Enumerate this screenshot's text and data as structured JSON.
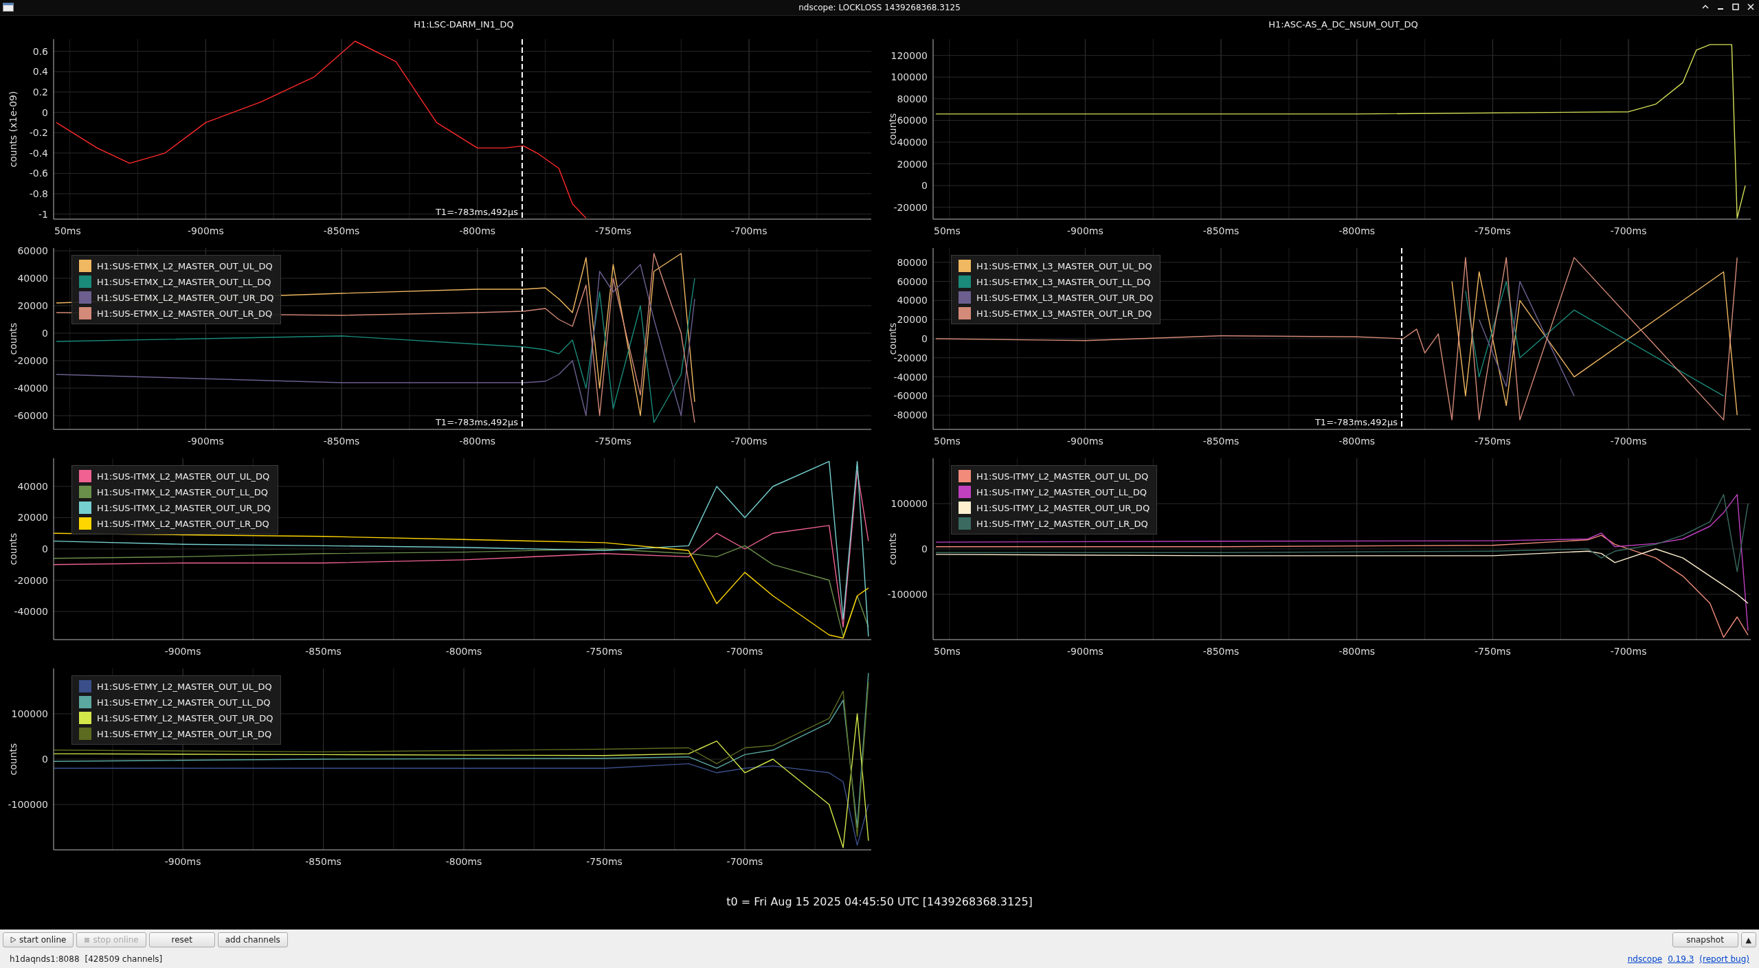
{
  "window": {
    "title": "ndscope: LOCKLOSS 1439268368.3125"
  },
  "plots": [
    {
      "cut_tick_label": "50ms",
      "chart_data": {
        "type": "line",
        "title": "H1:LSC-DARM_IN1_DQ",
        "ylabel": "counts (x1e-09)",
        "grid": true,
        "x": [
          -955,
          -940,
          -928,
          -915,
          -900,
          -880,
          -860,
          -845,
          -830,
          -815,
          -800,
          -790,
          -783,
          -778,
          -770,
          -765,
          -760
        ],
        "series": [
          {
            "color": "#ff2a2a",
            "values": [
              -0.1,
              -0.35,
              -0.5,
              -0.4,
              -0.1,
              0.1,
              0.35,
              0.7,
              0.5,
              -0.1,
              -0.35,
              -0.35,
              -0.33,
              -0.4,
              -0.55,
              -0.9,
              -1.04
            ]
          }
        ],
        "xlim": [
          -956,
          -655
        ],
        "ylim": [
          -1.05,
          0.72
        ],
        "xticks": [
          {
            "value": -900,
            "label": "-900ms"
          },
          {
            "value": -850,
            "label": "-850ms"
          },
          {
            "value": -800,
            "label": "-800ms"
          },
          {
            "value": -750,
            "label": "-750ms"
          },
          {
            "value": -700,
            "label": "-700ms"
          }
        ],
        "yticks": [
          -1,
          -0.8,
          -0.6,
          -0.4,
          -0.2,
          0,
          0.2,
          0.4,
          0.6
        ],
        "ref_lines": [
          {
            "axis": "x",
            "value": -783.5,
            "label": "T1=-783ms,492μs"
          }
        ]
      }
    },
    {
      "cut_tick_label": "50ms",
      "chart_data": {
        "type": "line",
        "title": "H1:ASC-AS_A_DC_NSUM_OUT_DQ",
        "ylabel": "counts",
        "grid": true,
        "x": [
          -955,
          -800,
          -700,
          -690,
          -680,
          -675,
          -670,
          -667,
          -662,
          -660,
          -657
        ],
        "series": [
          {
            "color": "#d4e157",
            "values": [
              66000,
              66000,
              68000,
              75000,
              95000,
              125000,
              130000,
              130000,
              130000,
              -30000,
              0
            ]
          }
        ],
        "xlim": [
          -956,
          -655
        ],
        "ylim": [
          -31000,
          135000
        ],
        "xticks": [
          {
            "value": -900,
            "label": "-900ms"
          },
          {
            "value": -850,
            "label": "-850ms"
          },
          {
            "value": -800,
            "label": "-800ms"
          },
          {
            "value": -750,
            "label": "-750ms"
          },
          {
            "value": -700,
            "label": "-700ms"
          }
        ],
        "yticks": [
          -20000,
          0,
          20000,
          40000,
          60000,
          80000,
          100000,
          120000
        ]
      }
    },
    {
      "chart_data": {
        "type": "line",
        "ylabel": "counts",
        "grid": true,
        "x": [
          -955,
          -850,
          -800,
          -783,
          -775,
          -770,
          -765,
          -760,
          -755,
          -750,
          -740,
          -735,
          -725,
          -720
        ],
        "series": [
          {
            "name": "H1:SUS-ETMX_L2_MASTER_OUT_UL_DQ",
            "color": "#f0b860",
            "values": [
              22000,
              29000,
              32000,
              32000,
              33000,
              25000,
              15000,
              55000,
              -40000,
              50000,
              -60000,
              45000,
              58000,
              -50000
            ]
          },
          {
            "name": "H1:SUS-ETMX_L2_MASTER_OUT_LL_DQ",
            "color": "#1a8a7a",
            "values": [
              -6000,
              -2000,
              -8000,
              -10000,
              -12000,
              -15000,
              -5000,
              -40000,
              30000,
              -55000,
              20000,
              -65000,
              -30000,
              40000
            ]
          },
          {
            "name": "H1:SUS-ETMX_L2_MASTER_OUT_UR_DQ",
            "color": "#6c5f8f",
            "values": [
              -30000,
              -36000,
              -36000,
              -36000,
              -35000,
              -30000,
              -20000,
              -60000,
              45000,
              30000,
              50000,
              10000,
              -60000,
              25000
            ]
          },
          {
            "name": "H1:SUS-ETMX_L2_MASTER_OUT_LR_DQ",
            "color": "#d48a78",
            "values": [
              15000,
              13000,
              15000,
              16000,
              18000,
              10000,
              5000,
              35000,
              -60000,
              40000,
              -45000,
              58000,
              0,
              -65000
            ]
          }
        ],
        "xlim": [
          -956,
          -655
        ],
        "ylim": [
          -70000,
          62000
        ],
        "xticks": [
          {
            "value": -900,
            "label": "-900ms"
          },
          {
            "value": -850,
            "label": "-850ms"
          },
          {
            "value": -800,
            "label": "-800ms"
          },
          {
            "value": -750,
            "label": "-750ms"
          },
          {
            "value": -700,
            "label": "-700ms"
          }
        ],
        "yticks": [
          -60000,
          -40000,
          -20000,
          0,
          20000,
          40000,
          60000
        ],
        "ref_lines": [
          {
            "axis": "x",
            "value": -783.5,
            "label": "T1=-783ms,492μs"
          }
        ]
      }
    },
    {
      "cut_tick_label": "50ms",
      "chart_data": {
        "type": "line",
        "ylabel": "counts",
        "grid": true,
        "x": [
          -955,
          -900,
          -850,
          -800,
          -783,
          -778,
          -775,
          -770,
          -765,
          -760,
          -755,
          -745,
          -740,
          -720,
          -665,
          -660
        ],
        "series": [
          {
            "name": "H1:SUS-ETMX_L3_MASTER_OUT_UL_DQ",
            "color": "#f0b860",
            "values": [
              null,
              null,
              null,
              null,
              null,
              null,
              null,
              null,
              60000,
              -60000,
              70000,
              -70000,
              40000,
              -40000,
              70000,
              -80000
            ]
          },
          {
            "name": "H1:SUS-ETMX_L3_MASTER_OUT_LL_DQ",
            "color": "#1a8a7a",
            "values": [
              null,
              null,
              null,
              null,
              null,
              null,
              null,
              null,
              null,
              50000,
              -40000,
              60000,
              -20000,
              30000,
              -60000,
              null
            ]
          },
          {
            "name": "H1:SUS-ETMX_L3_MASTER_OUT_UR_DQ",
            "color": "#6c5f8f",
            "values": [
              null,
              null,
              null,
              null,
              null,
              null,
              null,
              null,
              null,
              null,
              20000,
              -50000,
              60000,
              -60000,
              null,
              null
            ]
          },
          {
            "name": "H1:SUS-ETMX_L3_MASTER_OUT_LR_DQ",
            "color": "#d48a78",
            "values": [
              0,
              -2000,
              3000,
              2000,
              0,
              10000,
              -15000,
              5000,
              -85000,
              85000,
              -85000,
              85000,
              -85000,
              85000,
              -85000,
              85000
            ]
          }
        ],
        "xlim": [
          -956,
          -655
        ],
        "ylim": [
          -95000,
          95000
        ],
        "xticks": [
          {
            "value": -900,
            "label": "-900ms"
          },
          {
            "value": -850,
            "label": "-850ms"
          },
          {
            "value": -800,
            "label": "-800ms"
          },
          {
            "value": -750,
            "label": "-750ms"
          },
          {
            "value": -700,
            "label": "-700ms"
          }
        ],
        "yticks": [
          -80000,
          -60000,
          -40000,
          -20000,
          0,
          20000,
          40000,
          60000,
          80000
        ],
        "ref_lines": [
          {
            "axis": "x",
            "value": -783.5,
            "label": "T1=-783ms,492μs"
          }
        ]
      }
    },
    {
      "chart_data": {
        "type": "line",
        "ylabel": "counts",
        "grid": true,
        "x": [
          -946,
          -900,
          -850,
          -800,
          -750,
          -720,
          -710,
          -700,
          -690,
          -670,
          -665,
          -660,
          -656
        ],
        "series": [
          {
            "name": "H1:SUS-ITMX_L2_MASTER_OUT_UL_DQ",
            "color": "#f06292",
            "values": [
              -10000,
              -9000,
              -9000,
              -7000,
              -3000,
              -5000,
              10000,
              0,
              10000,
              15000,
              -50000,
              50000,
              5000
            ]
          },
          {
            "name": "H1:SUS-ITMX_L2_MASTER_OUT_LL_DQ",
            "color": "#6a8f4a",
            "values": [
              -6000,
              -5000,
              -3000,
              -2000,
              0,
              -3000,
              -5000,
              2000,
              -10000,
              -20000,
              -56000,
              -30000,
              -50000
            ]
          },
          {
            "name": "H1:SUS-ITMX_L2_MASTER_OUT_UR_DQ",
            "color": "#76d0d0",
            "values": [
              5000,
              3000,
              2000,
              1000,
              -1000,
              2000,
              40000,
              20000,
              40000,
              56000,
              -45000,
              56000,
              -56000
            ]
          },
          {
            "name": "H1:SUS-ITMX_L2_MASTER_OUT_LR_DQ",
            "color": "#ffd600",
            "values": [
              10000,
              9000,
              8000,
              6000,
              4000,
              -1000,
              -35000,
              -15000,
              -30000,
              -55000,
              -57000,
              -30000,
              -25000
            ]
          }
        ],
        "xlim": [
          -946,
          -655
        ],
        "ylim": [
          -58000,
          58000
        ],
        "xticks": [
          {
            "value": -900,
            "label": "-900ms"
          },
          {
            "value": -850,
            "label": "-850ms"
          },
          {
            "value": -800,
            "label": "-800ms"
          },
          {
            "value": -750,
            "label": "-750ms"
          },
          {
            "value": -700,
            "label": "-700ms"
          }
        ],
        "yticks": [
          -40000,
          -20000,
          0,
          20000,
          40000
        ]
      }
    },
    {
      "cut_tick_label": "50ms",
      "chart_data": {
        "type": "line",
        "ylabel": "counts",
        "grid": true,
        "x": [
          -955,
          -850,
          -750,
          -715,
          -710,
          -705,
          -690,
          -680,
          -670,
          -665,
          -660,
          -656
        ],
        "series": [
          {
            "name": "H1:SUS-ITMY_L2_MASTER_OUT_UL_DQ",
            "color": "#f28b7a",
            "values": [
              5000,
              5000,
              8000,
              20000,
              30000,
              10000,
              -20000,
              -60000,
              -120000,
              -195000,
              -150000,
              -190000
            ]
          },
          {
            "name": "H1:SUS-ITMY_L2_MASTER_OUT_LL_DQ",
            "color": "#c040c0",
            "values": [
              15000,
              17000,
              18000,
              22000,
              35000,
              5000,
              12000,
              22000,
              50000,
              80000,
              120000,
              -180000
            ]
          },
          {
            "name": "H1:SUS-ITMY_L2_MASTER_OUT_UR_DQ",
            "color": "#fff0d0",
            "values": [
              -12000,
              -15000,
              -15000,
              -5000,
              -10000,
              -30000,
              0,
              -20000,
              -60000,
              -80000,
              -100000,
              -120000
            ]
          },
          {
            "name": "H1:SUS-ITMY_L2_MASTER_OUT_LR_DQ",
            "color": "#3a6a60",
            "values": [
              -8000,
              -8000,
              -5000,
              0,
              -20000,
              -5000,
              10000,
              30000,
              60000,
              120000,
              -50000,
              100000
            ]
          }
        ],
        "xlim": [
          -956,
          -655
        ],
        "ylim": [
          -200000,
          200000
        ],
        "xticks": [
          {
            "value": -900,
            "label": "-900ms"
          },
          {
            "value": -850,
            "label": "-850ms"
          },
          {
            "value": -800,
            "label": "-800ms"
          },
          {
            "value": -750,
            "label": "-750ms"
          },
          {
            "value": -700,
            "label": "-700ms"
          }
        ],
        "yticks": [
          -100000,
          0,
          100000
        ]
      }
    },
    {
      "chart_data": {
        "type": "line",
        "ylabel": "counts",
        "grid": true,
        "x": [
          -946,
          -850,
          -750,
          -720,
          -710,
          -700,
          -690,
          -670,
          -665,
          -660,
          -656
        ],
        "series": [
          {
            "name": "H1:SUS-ETMY_L2_MASTER_OUT_UL_DQ",
            "color": "#3a4f8a",
            "values": [
              -20000,
              -20000,
              -20000,
              -10000,
              -30000,
              -20000,
              -15000,
              -30000,
              -50000,
              -190000,
              -100000
            ]
          },
          {
            "name": "H1:SUS-ETMY_L2_MASTER_OUT_LL_DQ",
            "color": "#5aa8a0",
            "values": [
              -5000,
              0,
              2000,
              5000,
              -20000,
              10000,
              20000,
              80000,
              130000,
              -150000,
              190000
            ]
          },
          {
            "name": "H1:SUS-ETMY_L2_MASTER_OUT_UR_DQ",
            "color": "#d4e84a",
            "values": [
              12000,
              10000,
              8000,
              12000,
              40000,
              -30000,
              0,
              -100000,
              -195000,
              100000,
              -180000
            ]
          },
          {
            "name": "H1:SUS-ETMY_L2_MASTER_OUT_LR_DQ",
            "color": "#5c6b20",
            "values": [
              20000,
              16000,
              22000,
              25000,
              -10000,
              25000,
              30000,
              90000,
              150000,
              -170000,
              170000
            ]
          }
        ],
        "xlim": [
          -946,
          -655
        ],
        "ylim": [
          -200000,
          200000
        ],
        "xticks": [
          {
            "value": -900,
            "label": "-900ms"
          },
          {
            "value": -850,
            "label": "-850ms"
          },
          {
            "value": -800,
            "label": "-800ms"
          },
          {
            "value": -750,
            "label": "-750ms"
          },
          {
            "value": -700,
            "label": "-700ms"
          }
        ],
        "yticks": [
          -100000,
          0,
          100000
        ]
      }
    }
  ],
  "time_label": "t0 = Fri Aug 15 2025 04:45:50 UTC [1439268368.3125]",
  "toolbar": {
    "left": [
      {
        "label": "start online",
        "kind": "start",
        "disabled": false
      },
      {
        "label": "stop online",
        "kind": "stop",
        "disabled": true
      },
      {
        "label": "reset",
        "kind": "plain",
        "disabled": false
      },
      {
        "label": "add channels",
        "kind": "plain",
        "disabled": false
      }
    ],
    "right": [
      {
        "label": "snapshot"
      },
      {
        "label": "▲"
      }
    ]
  },
  "status_bar": {
    "server": "h1daqnds1:8088",
    "channels": "[428509 channels]",
    "app": "ndscope",
    "version": "0.19.3",
    "report": "(report bug)"
  }
}
